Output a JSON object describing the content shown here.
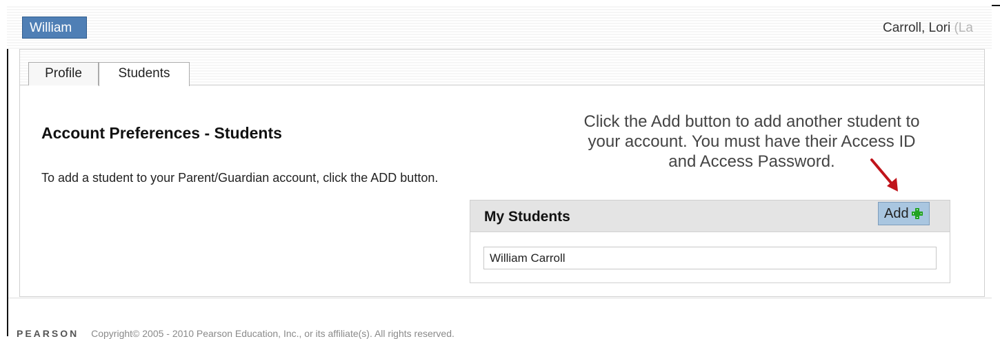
{
  "header": {
    "student_button_label": "William",
    "user_name": "Carroll, Lori",
    "user_name_suffix": "(La"
  },
  "tabs": [
    {
      "label": "Profile"
    },
    {
      "label": "Students"
    }
  ],
  "main": {
    "heading": "Account Preferences - Students",
    "instruction": "To add a student to your Parent/Guardian account, click the ADD button."
  },
  "callout": {
    "line1": "Click the Add button to add another student to",
    "line2": "your account. You must have their Access ID",
    "line3": "and Access Password."
  },
  "my_students": {
    "title": "My Students",
    "add_label": "Add",
    "students": [
      {
        "name": "William Carroll"
      }
    ]
  },
  "footer": {
    "logo_text": "PEARSON",
    "copyright": "Copyright© 2005 - 2010 Pearson Education, Inc., or its affiliate(s). All rights reserved."
  },
  "colors": {
    "student_button": "#4f7fb5",
    "add_button": "#a9c6e0",
    "plus_icon": "#22a322",
    "arrow": "#c0141b"
  }
}
